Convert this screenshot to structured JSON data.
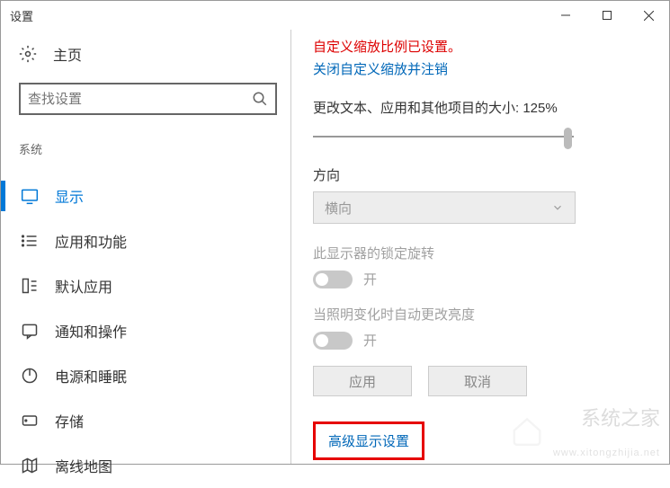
{
  "title": "设置",
  "home": "主页",
  "search_placeholder": "查找设置",
  "section": "系统",
  "nav": [
    {
      "label": "显示"
    },
    {
      "label": "应用和功能"
    },
    {
      "label": "默认应用"
    },
    {
      "label": "通知和操作"
    },
    {
      "label": "电源和睡眠"
    },
    {
      "label": "存储"
    },
    {
      "label": "离线地图"
    }
  ],
  "right": {
    "warning": "自定义缩放比例已设置。",
    "close_link": "关闭自定义缩放并注销",
    "scale_label": "更改文本、应用和其他项目的大小: 125%",
    "orientation_label": "方向",
    "orientation_value": "横向",
    "lock_label": "此显示器的锁定旋转",
    "on1": "开",
    "brightness_label": "当照明变化时自动更改亮度",
    "on2": "开",
    "apply": "应用",
    "cancel": "取消",
    "advanced": "高级显示设置"
  },
  "watermark": {
    "cn": "系统之家",
    "en": "www.xitongzhijia.net"
  }
}
